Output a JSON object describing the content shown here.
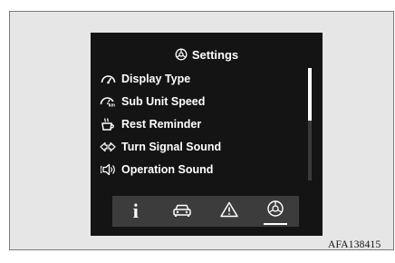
{
  "screen": {
    "title": "Settings",
    "title_icon": "settings-gear-icon",
    "menu_items": [
      {
        "label": "Display Type",
        "icon": "gauge-icon"
      },
      {
        "label": "Sub Unit Speed",
        "icon": "sub-speed-gauge-icon"
      },
      {
        "label": "Rest Reminder",
        "icon": "coffee-cup-icon"
      },
      {
        "label": "Turn Signal Sound",
        "icon": "turn-signal-arrows-icon"
      },
      {
        "label": "Operation Sound",
        "icon": "speaker-icon"
      }
    ],
    "scroll_position": 0,
    "tabs": [
      {
        "name": "info",
        "icon": "info-icon",
        "glyph": "i",
        "active": false
      },
      {
        "name": "vehicle",
        "icon": "car-icon",
        "active": false
      },
      {
        "name": "warning",
        "icon": "warning-icon",
        "active": false
      },
      {
        "name": "settings",
        "icon": "settings-gear-icon",
        "active": true
      }
    ]
  },
  "caption": "AFA138415",
  "colors": {
    "screen_background": "#141414",
    "tab_bar_background": "#3c3c3c",
    "frame_background": "#e6e6e6",
    "text": "#ffffff"
  }
}
